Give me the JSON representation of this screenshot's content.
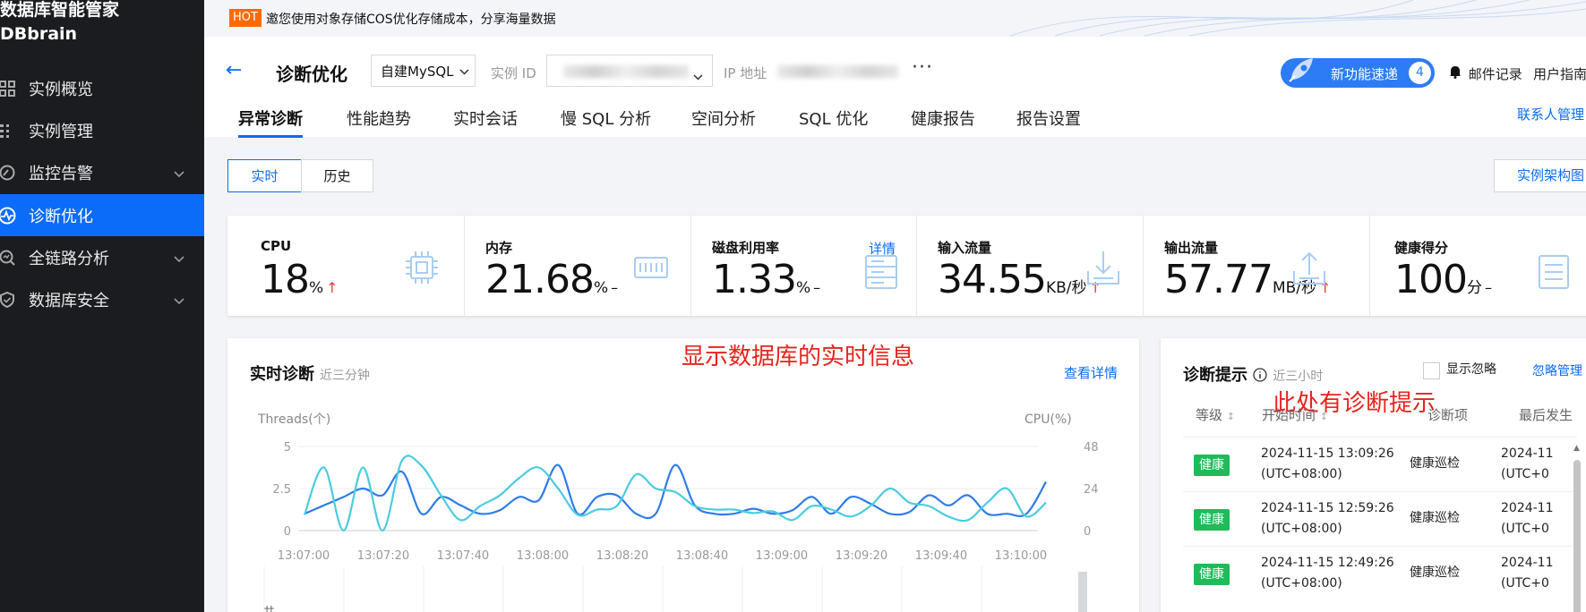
{
  "sidebar": {
    "brand_cn": "数据库智能管家",
    "brand_en": "DBbrain",
    "items": [
      {
        "label": "实例概览",
        "icon": "grid-icon"
      },
      {
        "label": "实例管理",
        "icon": "list-icon"
      },
      {
        "label": "监控告警",
        "icon": "gauge-icon"
      },
      {
        "label": "诊断优化",
        "icon": "pulse-icon"
      },
      {
        "label": "全链路分析",
        "icon": "search-chart-icon"
      },
      {
        "label": "数据库安全",
        "icon": "shield-icon"
      }
    ]
  },
  "banner": {
    "badge": "HOT",
    "text": "邀您使用对象存储COS优化存储成本，分享海量数据"
  },
  "header": {
    "title": "诊断优化",
    "db_type": "自建MySQL",
    "instance_label": "实例 ID",
    "ip_label": "IP 地址",
    "new_feature": "新功能速递",
    "new_feature_count": "4",
    "mail_log": "邮件记录",
    "user_guide": "用户指南",
    "contact": "联系人管理"
  },
  "tabs": [
    "异常诊断",
    "性能趋势",
    "实时会话",
    "慢 SQL 分析",
    "空间分析",
    "SQL 优化",
    "健康报告",
    "报告设置"
  ],
  "mode": {
    "realtime": "实时",
    "history": "历史",
    "arch": "实例架构图"
  },
  "metrics": [
    {
      "title": "CPU",
      "value": "18",
      "unit": "%",
      "trend": "↑"
    },
    {
      "title": "内存",
      "value": "21.68",
      "unit": "%",
      "trend": "–"
    },
    {
      "title": "磁盘利用率",
      "value": "1.33",
      "unit": "%",
      "trend": "–",
      "link": "详情"
    },
    {
      "title": "输入流量",
      "value": "34.55",
      "unit": "KB/秒",
      "trend": "↑"
    },
    {
      "title": "输出流量",
      "value": "57.77",
      "unit": "MB/秒",
      "trend": "↑"
    },
    {
      "title": "健康得分",
      "value": "100",
      "unit": "分",
      "trend": "–"
    }
  ],
  "realtime_panel": {
    "title": "实时诊断",
    "subtitle": "近三分钟",
    "annotation": "显示数据库的实时信息",
    "detail_link": "查看详情",
    "bottom_label": "共"
  },
  "chart_data": {
    "type": "line",
    "ylabel_left": "Threads(个)",
    "ylabel_right": "CPU(%)",
    "y_left_ticks": [
      "5",
      "2.5",
      "0"
    ],
    "y_right_ticks": [
      "48",
      "24",
      "0"
    ],
    "ylim_left": [
      0,
      5
    ],
    "ylim_right": [
      0,
      48
    ],
    "x_ticks": [
      "13:07:00",
      "13:07:20",
      "13:07:40",
      "13:08:00",
      "13:08:20",
      "13:08:40",
      "13:09:00",
      "13:09:20",
      "13:09:40",
      "13:10:00"
    ],
    "series": [
      {
        "color": "#2f7ce8",
        "axis": "left",
        "values": [
          1.0,
          1.5,
          2.0,
          2.5,
          2.1,
          3.5,
          1.0,
          2.0,
          1.5,
          1.0,
          1.2,
          2.0,
          1.8,
          3.9,
          1.0,
          2.0,
          2.1,
          1.0,
          1.0,
          3.9,
          1.5,
          1.0,
          1.0,
          1.3,
          1.0,
          1.2,
          2.0,
          1.0,
          2.0,
          1.6,
          1.0,
          1.1,
          2.1,
          1.5,
          2.1,
          1.0,
          1.0,
          1.0,
          2.9
        ]
      },
      {
        "color": "#4ccbe0",
        "axis": "right",
        "values": [
          9,
          36,
          0,
          36,
          0,
          40,
          37,
          20,
          6,
          14,
          20,
          30,
          36,
          24,
          9,
          12,
          14,
          32,
          24,
          22,
          14,
          12,
          12,
          10,
          11,
          6,
          14,
          12,
          8,
          14,
          24,
          16,
          14,
          8,
          6,
          16,
          24,
          8,
          16
        ]
      }
    ]
  },
  "diag_panel": {
    "title": "诊断提示",
    "subtitle": "近三小时",
    "annotation": "此处有诊断提示",
    "show_ignored": "显示忽略",
    "ignore_manage": "忽略管理",
    "columns": [
      "等级",
      "开始时间",
      "诊断项",
      "最后发生"
    ],
    "rows": [
      {
        "level": "健康",
        "start_date": "2024-11-15 13:09:26",
        "start_tz": "(UTC+08:00)",
        "item": "健康巡检",
        "last_date": "2024-11",
        "last_tz": "(UTC+0"
      },
      {
        "level": "健康",
        "start_date": "2024-11-15 12:59:26",
        "start_tz": "(UTC+08:00)",
        "item": "健康巡检",
        "last_date": "2024-11",
        "last_tz": "(UTC+0"
      },
      {
        "level": "健康",
        "start_date": "2024-11-15 12:49:26",
        "start_tz": "(UTC+08:00)",
        "item": "健康巡检",
        "last_date": "2024-11",
        "last_tz": "(UTC+0"
      }
    ]
  },
  "colors": {
    "primary": "#0a6cf8",
    "sidebar_bg": "#1a1c1f",
    "healthy": "#1fbb59",
    "alert_red": "#e8231b"
  }
}
